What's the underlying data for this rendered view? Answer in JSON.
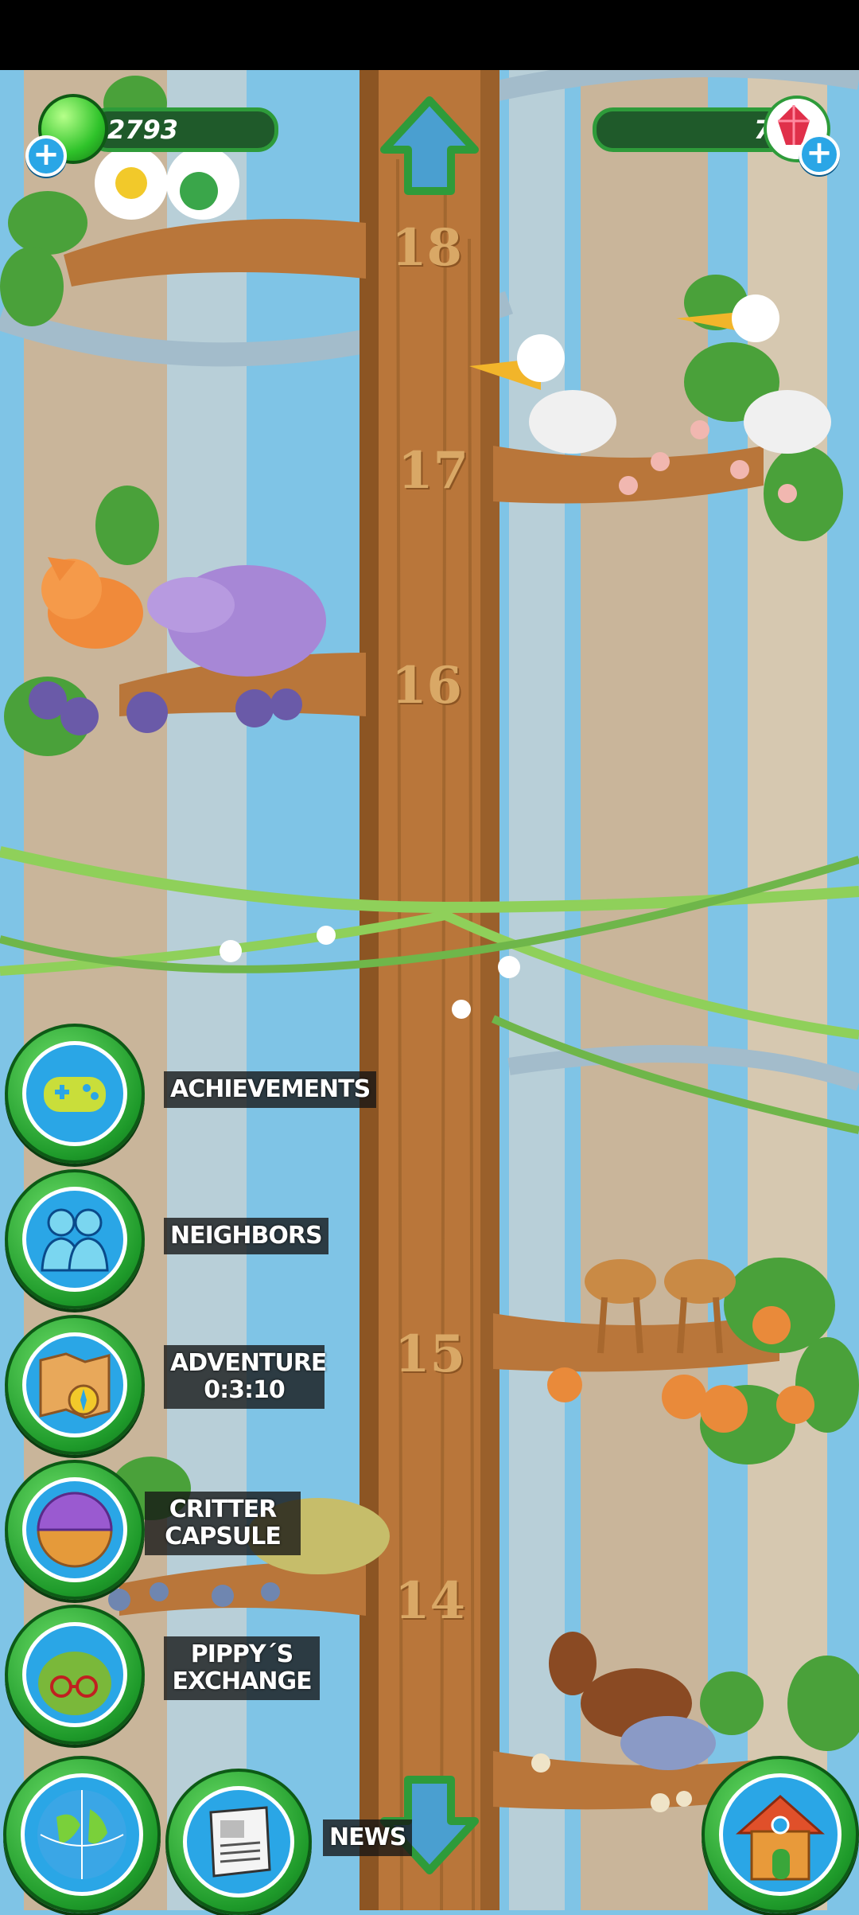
{
  "hud": {
    "currency_value": "2793",
    "gems_value": "7",
    "currency_icon": "green-gem-icon",
    "gems_icon": "red-crystal-icon",
    "add_icon": "plus-icon"
  },
  "tree": {
    "levels": [
      "18",
      "17",
      "16",
      "15",
      "14"
    ]
  },
  "menu": {
    "achievements": "ACHIEVEMENTS",
    "neighbors": "NEIGHBORS",
    "adventure_line1": "ADVENTURE",
    "adventure_timer": "0:3:10",
    "critter_line1": "CRITTER",
    "critter_line2": "CAPSULE",
    "pippy_line1": "PIPPY´S",
    "pippy_line2": "EXCHANGE",
    "news": "NEWS"
  },
  "colors": {
    "sky": "#7fc4e6",
    "trunk": "#b9763a",
    "button_green": "#2e9b3a",
    "button_blue": "#2aa6e6"
  }
}
